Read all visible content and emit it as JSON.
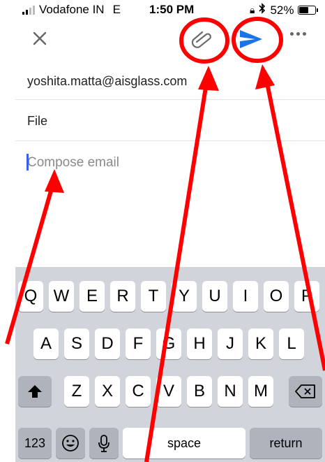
{
  "status_bar": {
    "carrier": "Vodafone IN",
    "network": "E",
    "time": "1:50 PM",
    "battery": "52%",
    "battery_level": 0.52
  },
  "toolbar": {
    "close_icon": "close-icon",
    "attach_icon": "paperclip-icon",
    "send_icon": "send-icon",
    "more_icon": "more-icon"
  },
  "compose": {
    "to": "yoshita.matta@aisglass.com",
    "subject": "File",
    "body_placeholder": "Compose email"
  },
  "keyboard": {
    "row1": [
      "Q",
      "W",
      "E",
      "R",
      "T",
      "Y",
      "U",
      "I",
      "O",
      "P"
    ],
    "row2": [
      "A",
      "S",
      "D",
      "F",
      "G",
      "H",
      "J",
      "K",
      "L"
    ],
    "row3": [
      "Z",
      "X",
      "C",
      "V",
      "B",
      "N",
      "M"
    ],
    "numbers_key": "123",
    "space_key": "space",
    "return_key": "return",
    "shift_icon": "shift-icon",
    "delete_icon": "delete-icon",
    "emoji_icon": "emoji-icon",
    "mic_icon": "microphone-icon"
  },
  "annotation_color": "#ff0000",
  "send_color": "#1a73e8"
}
